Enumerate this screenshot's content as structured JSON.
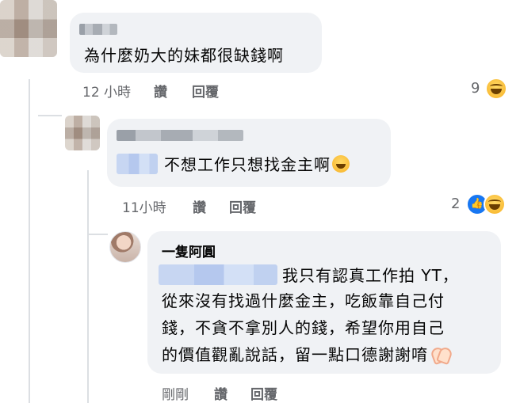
{
  "comments": [
    {
      "text": "為什麼奶大的妹都很缺錢啊",
      "time": "12 小時",
      "like_label": "讚",
      "reply_label": "回覆",
      "reaction_count": "9",
      "reactions": [
        "haha-icon"
      ]
    },
    {
      "text": "不想工作只想找金主啊",
      "time": "11小時",
      "like_label": "讚",
      "reply_label": "回覆",
      "reaction_count": "2",
      "reactions": [
        "like-icon",
        "haha-icon"
      ]
    },
    {
      "author": "一隻阿圓",
      "lines": [
        "我只有認真工作拍 YT，",
        "從來沒有找過什麼金主，吃飯靠自己付",
        "錢，不貪不拿別人的錢，希望你用自己",
        "的價值觀亂說話，留一點口德謝謝唷"
      ],
      "time": "剛剛",
      "like_label": "讚",
      "reply_label": "回覆"
    }
  ],
  "colors": {
    "bubble": "#f0f2f5",
    "meta_text": "#65676b",
    "like_blue": "#1877f2"
  }
}
